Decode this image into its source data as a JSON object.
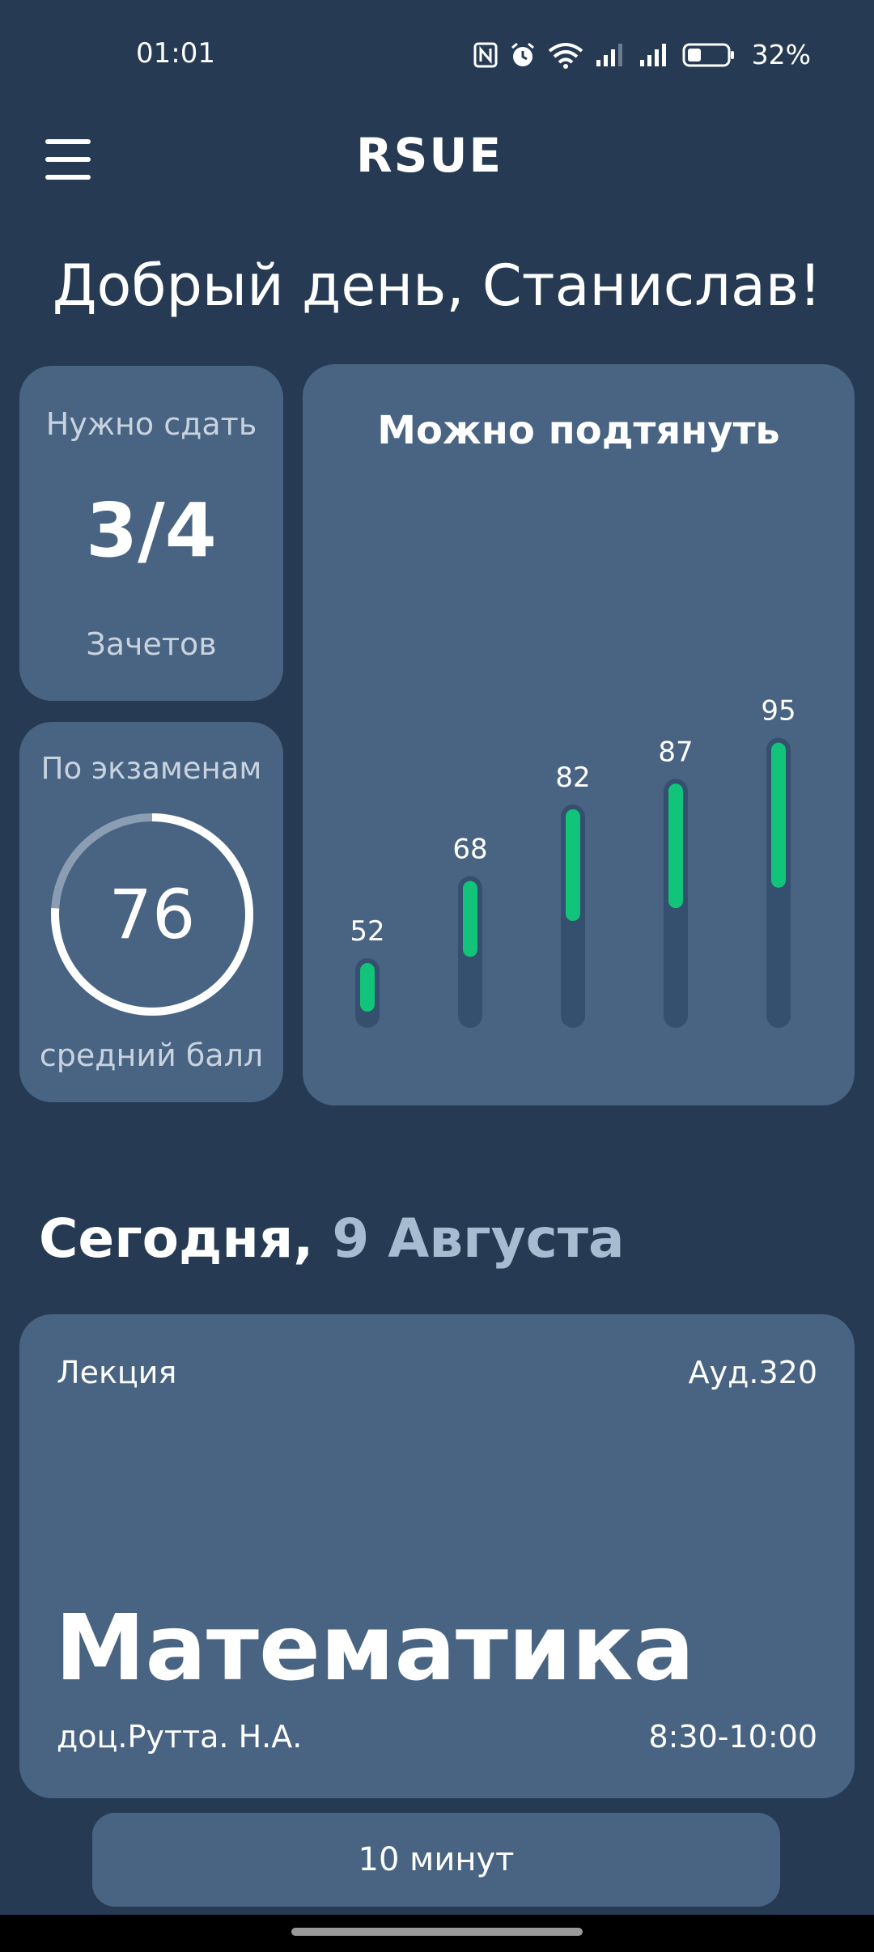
{
  "status_bar": {
    "time": "01:01",
    "battery_percent": "32%",
    "icons": [
      "nfc-icon",
      "alarm-icon",
      "wifi-icon",
      "signal-icon",
      "signal-icon",
      "battery-icon"
    ]
  },
  "header": {
    "logo": "RSUE",
    "menu_icon": "hamburger-menu-icon"
  },
  "greeting": "Добрый день, Станислав!",
  "credits_card": {
    "caption_top": "Нужно сдать",
    "value": "3/4",
    "caption_bottom": "Зачетов"
  },
  "exams_card": {
    "caption_top": "По экзаменам",
    "value": "76",
    "caption_bottom": "средний балл",
    "ring_fraction": 0.76
  },
  "chart_data": {
    "type": "bar",
    "title": "Можно подтянуть",
    "values": [
      52,
      68,
      82,
      87,
      95
    ],
    "data_labels": [
      "52",
      "68",
      "82",
      "87",
      "95"
    ],
    "bar_color": "#12c47a",
    "track_color": "#34506e"
  },
  "today": {
    "prefix": "Сегодня,",
    "date": "9 Августа"
  },
  "lesson": {
    "type": "Лекция",
    "room": "Ауд.320",
    "subject": "Математика",
    "teacher": "доц.Рутта. Н.А.",
    "time": "8:30-10:00"
  },
  "countdown": "10 минут",
  "colors": {
    "background": "#263a53",
    "card": "#486482",
    "accent": "#12c47a",
    "muted_text": "#c9d3df"
  }
}
